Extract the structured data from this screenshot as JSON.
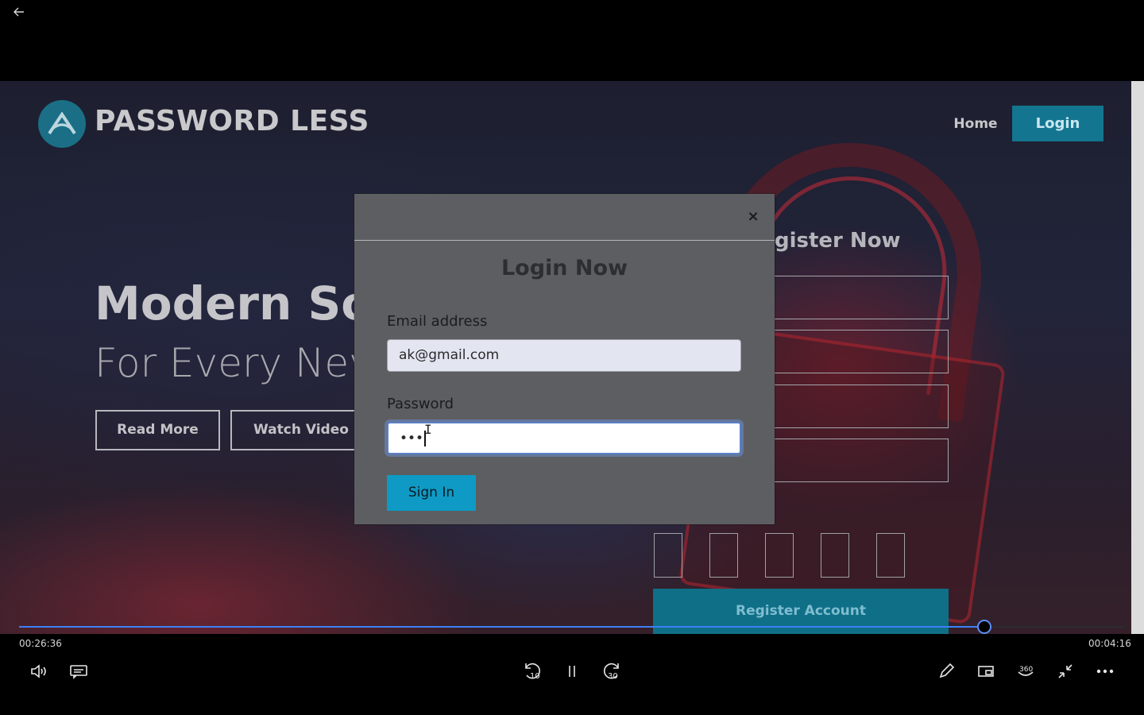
{
  "player": {
    "time_elapsed": "00:26:36",
    "time_remaining": "00:04:16",
    "progress": 0.873,
    "skip_back_label": "10",
    "skip_forward_label": "30",
    "accent_color": "#3d7ff6"
  },
  "site": {
    "title": "PASSWORD LESS",
    "nav": {
      "home": "Home",
      "login": "Login"
    },
    "hero": {
      "title": "Modern Sol",
      "subtitle": "For Every Nev",
      "read_more": "Read More",
      "watch_video": "Watch Video"
    },
    "register": {
      "title": "gister Now",
      "button": "Register Account"
    },
    "brand_color": "#147591"
  },
  "modal": {
    "close_symbol": "×",
    "title": "Login Now",
    "email_label": "Email address",
    "email_value": "ak@gmail.com",
    "password_label": "Password",
    "password_value": "•••",
    "sign_in": "Sign In",
    "sign_in_color": "#0e9ac4"
  }
}
